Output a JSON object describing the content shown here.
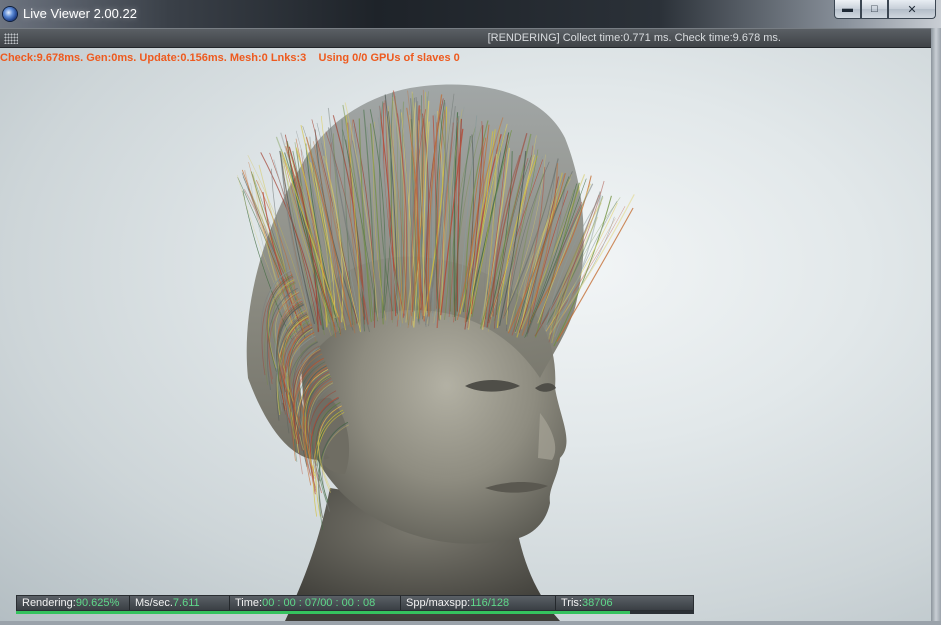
{
  "window": {
    "title": "Live Viewer 2.00.22",
    "buttons": {
      "minimize": "▬",
      "maximize": "□",
      "close": "✕"
    }
  },
  "header": {
    "status": "[RENDERING] Collect time:0.771 ms.  Check time:9.678 ms."
  },
  "overlay": {
    "info": "Check:9.678ms. Gen:0ms. Update:0.156ms. Mesh:0 Lnks:3    Using 0/0 GPUs of slaves 0"
  },
  "stats": {
    "rendering_label": "Rendering:",
    "rendering_value": "90.625%",
    "ms_label": "Ms/sec. ",
    "ms_value": "7.611",
    "time_label": "Time: ",
    "time_value": "00 : 00 : 07/00 : 00 : 08",
    "spp_label": "Spp/maxspp: ",
    "spp_value": "116/128",
    "tris_label": "Tris:   ",
    "tris_value": "38706",
    "progress": 0.90625
  },
  "colors": {
    "overlay_text": "#ee5a1e",
    "stat_value": "#5fd98a",
    "progress": "#35c25e"
  }
}
